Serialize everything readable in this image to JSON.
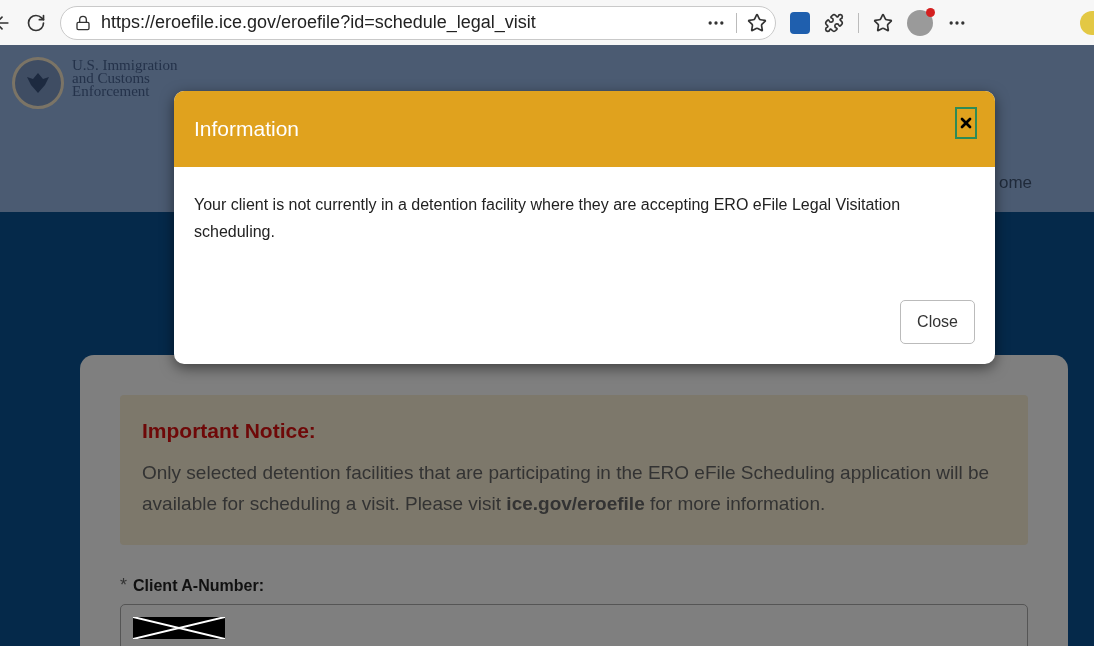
{
  "browser": {
    "url": "https://eroefile.ice.gov/eroefile?id=schedule_legal_visit"
  },
  "header": {
    "logo_lines": [
      "U.S. Immigration",
      "and Customs",
      "Enforcement"
    ],
    "nav_item": "ome"
  },
  "notice": {
    "title": "Important Notice:",
    "text": "Only selected detention facilities that are participating in the ERO eFile Scheduling application will be available for scheduling a visit. Please visit **ice.gov/eroefile** for more information."
  },
  "form": {
    "required_mark": "*",
    "label": "Client A-Number:"
  },
  "dialog": {
    "title": "Information",
    "message": "Your client is not currently in a detention facility where they are accepting ERO eFile Legal Visitation scheduling.",
    "button": "Close"
  }
}
